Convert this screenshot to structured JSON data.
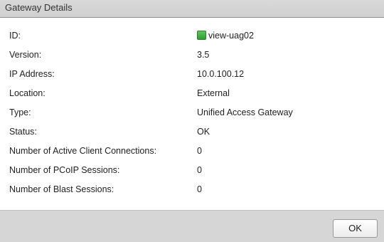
{
  "dialog": {
    "title": "Gateway Details"
  },
  "details": [
    {
      "label": "ID:",
      "value": "view-uag02",
      "icon": "green-status-square",
      "icon_color": "#3cb33c"
    },
    {
      "label": "Version:",
      "value": "3.5"
    },
    {
      "label": "IP Address:",
      "value": "10.0.100.12"
    },
    {
      "label": "Location:",
      "value": "External"
    },
    {
      "label": "Type:",
      "value": "Unified Access Gateway"
    },
    {
      "label": "Status:",
      "value": "OK"
    },
    {
      "label": "Number of Active Client Connections:",
      "value": "0"
    },
    {
      "label": "Number of PCoIP Sessions:",
      "value": "0"
    },
    {
      "label": "Number of Blast Sessions:",
      "value": "0"
    }
  ],
  "footer": {
    "ok_label": "OK"
  }
}
